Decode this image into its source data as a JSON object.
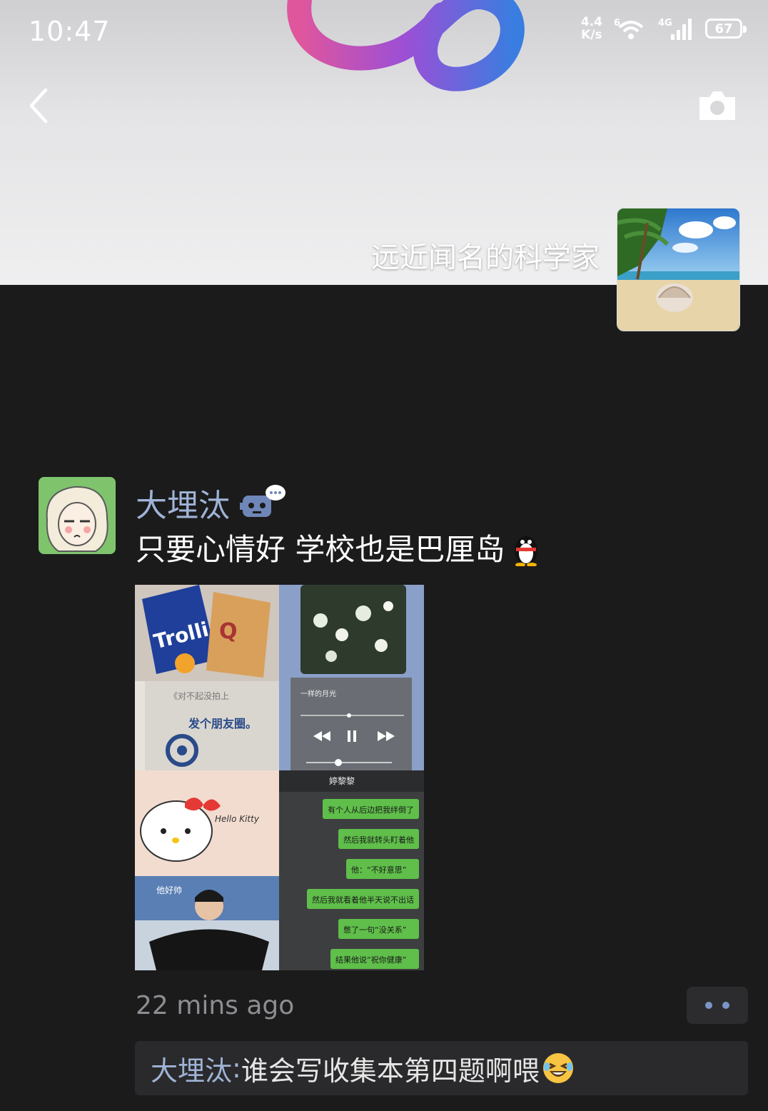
{
  "status_bar": {
    "time": "10:47",
    "net_speed_value": "4.4",
    "net_speed_unit": "K/s",
    "wifi_badge": "6",
    "cell_badge": "4G",
    "battery": "67"
  },
  "profile": {
    "name": "远近闻名的科学家"
  },
  "post": {
    "author": "大埋汰",
    "text": "只要心情好 学校也是巴厘岛",
    "time": "22 mins ago",
    "collage": {
      "candy_brand": "Trolli",
      "note_line1": "《对不起没拍上",
      "note_line2": "发个朋友圈。",
      "music_title": "一样的月光",
      "chat_header": "婷黎黎",
      "chat_lines": [
        "有个人从后边把我绊倒了",
        "然后我就转头盯着他",
        "他：“不好意思”",
        "然后我就看着他半天说不出话",
        "憋了一句“没关系”",
        "结果他说“祝你健康”"
      ],
      "kitty_label": "Hello Kitty",
      "photo_caption": "他好帅"
    }
  },
  "comment": {
    "author": "大埋汰",
    "separator": ": ",
    "text": "谁会写收集本第四题啊喂"
  }
}
